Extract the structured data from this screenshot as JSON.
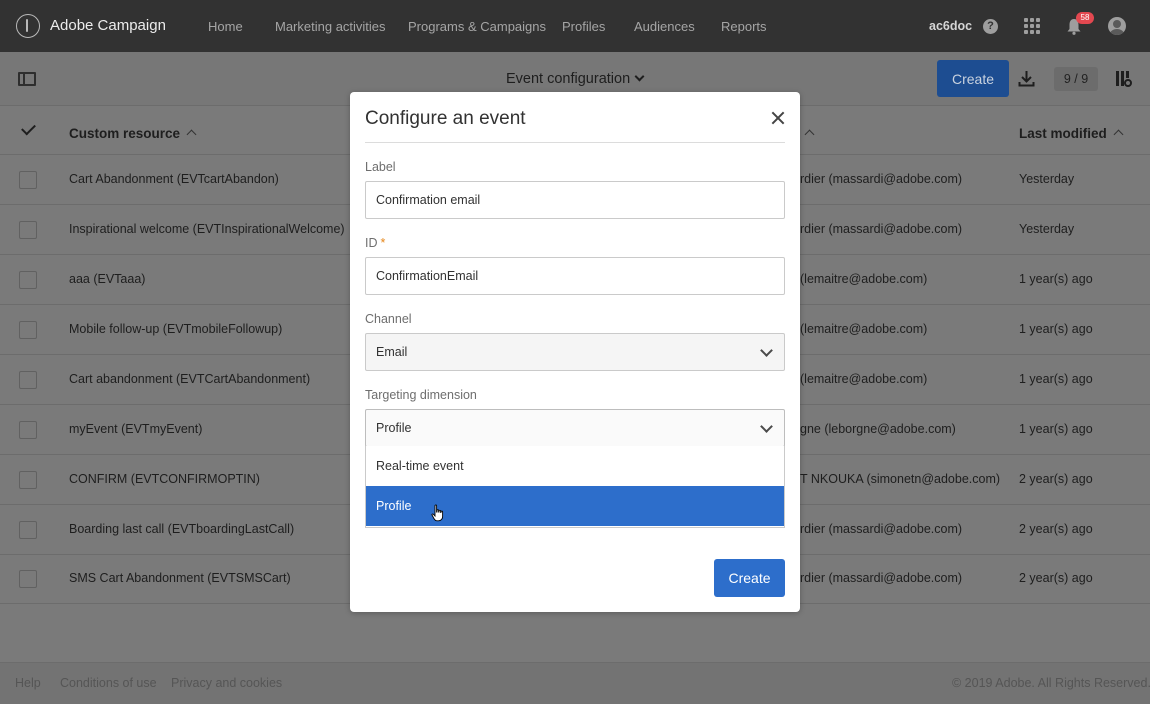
{
  "app": {
    "title": "Adobe Campaign",
    "user_code": "ac6doc",
    "notification_count": "58"
  },
  "nav": [
    "Home",
    "Marketing activities",
    "Programs & Campaigns",
    "Profiles",
    "Audiences",
    "Reports"
  ],
  "toolbar": {
    "heading": "Event configuration",
    "create_label": "Create",
    "pager": "9 / 9"
  },
  "table": {
    "columns": [
      "Custom resource",
      "Last modified"
    ],
    "rows": [
      {
        "name": "Cart Abandonment (EVTcartAbandon)",
        "owner": "rdier (massardi@adobe.com)",
        "modified": "Yesterday"
      },
      {
        "name": "Inspirational welcome (EVTInspirationalWelcome)",
        "owner": "rdier (massardi@adobe.com)",
        "modified": "Yesterday"
      },
      {
        "name": "aaa (EVTaaa)",
        "owner": "(lemaitre@adobe.com)",
        "modified": "1 year(s) ago"
      },
      {
        "name": "Mobile follow-up (EVTmobileFollowup)",
        "owner": "(lemaitre@adobe.com)",
        "modified": "1 year(s) ago"
      },
      {
        "name": "Cart abandonment (EVTCartAbandonment)",
        "owner": "(lemaitre@adobe.com)",
        "modified": "1 year(s) ago"
      },
      {
        "name": "myEvent (EVTmyEvent)",
        "owner": "gne (leborgne@adobe.com)",
        "modified": "1 year(s) ago"
      },
      {
        "name": "CONFIRM (EVTCONFIRMOPTIN)",
        "owner": "T NKOUKA (simonetn@adobe.com)",
        "modified": "2 year(s) ago"
      },
      {
        "name": "Boarding last call (EVTboardingLastCall)",
        "owner": "rdier (massardi@adobe.com)",
        "modified": "2 year(s) ago"
      },
      {
        "name": "SMS Cart Abandonment (EVTSMSCart)",
        "owner": "rdier (massardi@adobe.com)",
        "modified": "2 year(s) ago"
      }
    ]
  },
  "modal": {
    "title": "Configure an event",
    "label_caption": "Label",
    "label_value": "Confirmation email",
    "id_caption": "ID",
    "required_mark": "*",
    "id_value": "ConfirmationEmail",
    "channel_caption": "Channel",
    "channel_value": "Email",
    "targeting_caption": "Targeting dimension",
    "targeting_value": "Profile",
    "targeting_options": [
      "Real-time event",
      "Profile"
    ],
    "create_label": "Create"
  },
  "footer": {
    "help": "Help",
    "terms": "Conditions of use",
    "privacy": "Privacy and cookies",
    "copyright": "© 2019 Adobe. All Rights Reserved."
  },
  "colors": {
    "topbar": "#323232",
    "accent": "#2d6ecb",
    "overlay": "#7a7a7a",
    "badge": "#e34850",
    "required": "#e68619"
  },
  "icons": [
    "panel-icon",
    "chevron-down-icon",
    "download-icon",
    "layout-settings-icon",
    "help-icon",
    "apps-grid-icon",
    "bell-icon",
    "close-icon",
    "hand-cursor-icon"
  ]
}
